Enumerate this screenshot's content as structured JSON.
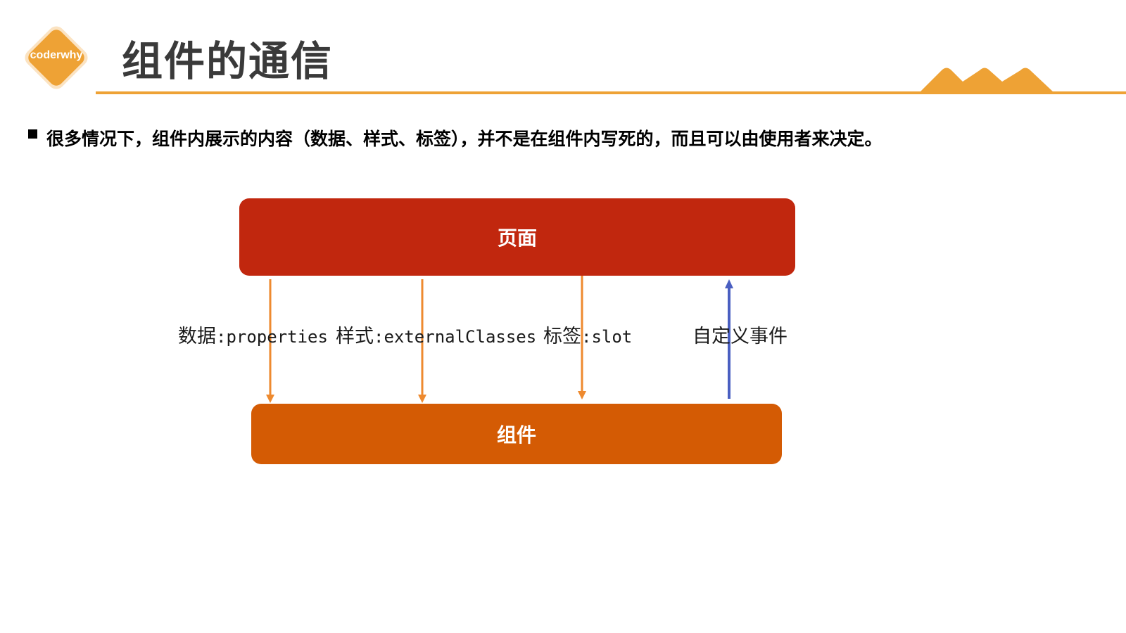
{
  "header": {
    "logo_text": "coderwhy",
    "title": "组件的通信"
  },
  "bullet": {
    "text": "很多情况下，组件内展示的内容（数据、样式、标签），并不是在组件内写死的，而且可以由使用者来决定。"
  },
  "diagram": {
    "top_box": "页面",
    "bottom_box": "组件",
    "labels": [
      {
        "zh": "数据",
        "code": ":properties"
      },
      {
        "zh": "样式",
        "code": ":externalClasses"
      },
      {
        "zh": "标签",
        "code": ":slot"
      },
      {
        "zh": "自定义事件",
        "code": ""
      }
    ]
  },
  "colors": {
    "accent": "#eea235",
    "page_box": "#c1270e",
    "component_box": "#d45b04",
    "down_arrow": "#ee8a2f",
    "up_arrow": "#4a5fc1"
  }
}
